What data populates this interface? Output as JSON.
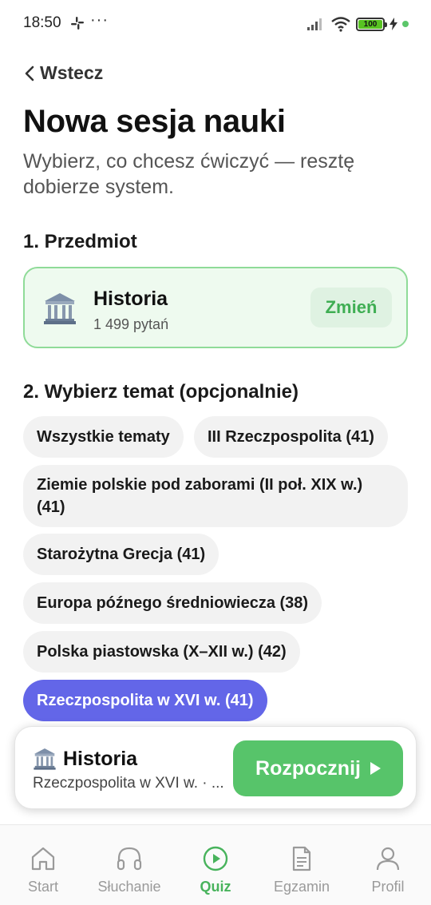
{
  "status_bar": {
    "time": "18:50",
    "dots": "···",
    "battery": "100"
  },
  "header": {
    "back_label": "Wstecz",
    "title": "Nowa sesja nauki",
    "subtitle": "Wybierz, co chcesz ćwiczyć — resztę dobierze system."
  },
  "subject_section": {
    "label": "1. Przedmiot",
    "icon": "classical-building-icon",
    "name": "Historia",
    "count": "1 499 pytań",
    "change_label": "Zmień"
  },
  "topic_section": {
    "label": "2. Wybierz temat (opcjonalnie)",
    "chips": [
      {
        "label": "Wszystkie tematy",
        "selected": false
      },
      {
        "label": "III Rzeczpospolita (41)",
        "selected": false
      },
      {
        "label": "Ziemie polskie pod zaborami (II poł. XIX w.) (41)",
        "selected": false
      },
      {
        "label": "Starożytna Grecja (41)",
        "selected": false
      },
      {
        "label": "Europa późnego średniowiecza (38)",
        "selected": false
      },
      {
        "label": "Polska piastowska (X–XII w.) (42)",
        "selected": false
      },
      {
        "label": "Rzeczpospolita w XVI w. (41)",
        "selected": true
      }
    ]
  },
  "start_card": {
    "icon": "classical-building-icon",
    "title": "Historia",
    "subtitle": "Rzeczpospolita w XVI w. · ...",
    "button_label": "Rozpocznij"
  },
  "bottom_nav": {
    "items": [
      {
        "label": "Start",
        "icon": "home-icon",
        "active": false
      },
      {
        "label": "Słuchanie",
        "icon": "headphones-icon",
        "active": false
      },
      {
        "label": "Quiz",
        "icon": "play-circle-icon",
        "active": true
      },
      {
        "label": "Egzamin",
        "icon": "document-icon",
        "active": false
      },
      {
        "label": "Profil",
        "icon": "user-icon",
        "active": false
      }
    ]
  },
  "colors": {
    "accent_green": "#57c46a",
    "selected_chip": "#6366e8",
    "card_border": "#8fdb98"
  }
}
